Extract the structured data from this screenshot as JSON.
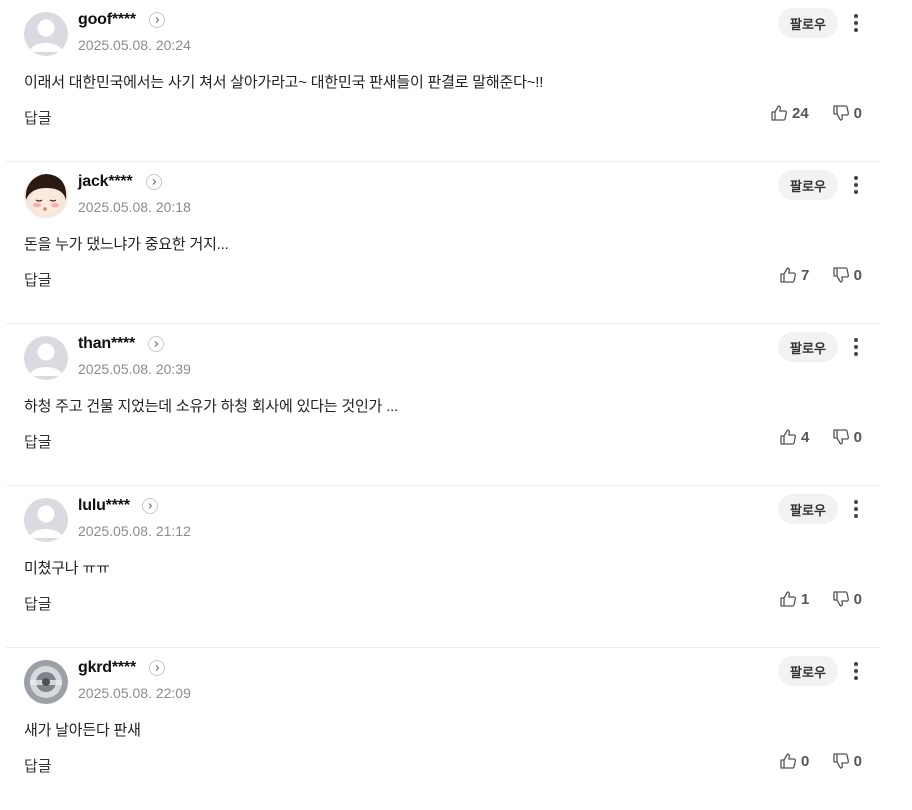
{
  "ui": {
    "follow_label": "팔로우",
    "reply_label": "답글",
    "colors": {
      "avatar_default_bg": "#d9dbe0",
      "avatar_default_fg": "#ffffff",
      "follow_bg": "#f2f2f2"
    }
  },
  "comments": [
    {
      "nickname": "goof****",
      "timestamp": "2025.05.08. 20:24",
      "text": "이래서 대한민국에서는 사기 쳐서 살아가라고~ 대한민국 판새들이 판결로 말해준다~!!",
      "likes": "24",
      "dislikes": "0",
      "avatar": "default-avatar-icon"
    },
    {
      "nickname": "jack****",
      "timestamp": "2025.05.08. 20:18",
      "text": "돈을 누가 댔느냐가 중요한 거지...",
      "likes": "7",
      "dislikes": "0",
      "avatar": "cartoon-face-avatar"
    },
    {
      "nickname": "than****",
      "timestamp": "2025.05.08. 20:39",
      "text": "하청 주고 건물 지었는데 소유가 하청 회사에 있다는 것인가 ...",
      "likes": "4",
      "dislikes": "0",
      "avatar": "default-avatar-icon"
    },
    {
      "nickname": "lulu****",
      "timestamp": "2025.05.08. 21:12",
      "text": "미쳤구나 ㅠㅠ",
      "likes": "1",
      "dislikes": "0",
      "avatar": "default-avatar-icon"
    },
    {
      "nickname": "gkrd****",
      "timestamp": "2025.05.08. 22:09",
      "text": "새가 날아든다 판새",
      "likes": "0",
      "dislikes": "0",
      "avatar": "photo-avatar"
    }
  ]
}
